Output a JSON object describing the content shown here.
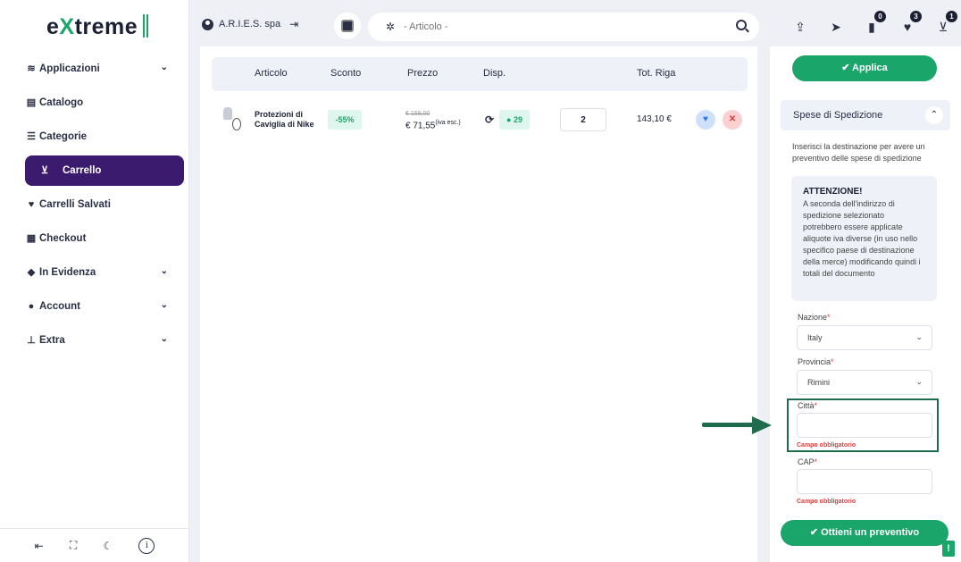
{
  "logo": {
    "part1": "e",
    "part2": "X",
    "part3": "treme"
  },
  "sidebar": {
    "items": [
      {
        "label": "Applicazioni",
        "icon": "layers-icon",
        "expandable": true
      },
      {
        "label": "Catalogo",
        "icon": "catalog-icon",
        "expandable": false
      },
      {
        "label": "Categorie",
        "icon": "list-icon",
        "expandable": false
      },
      {
        "label": "Carrello",
        "icon": "cart-icon",
        "expandable": false,
        "active": true
      },
      {
        "label": "Carrelli Salvati",
        "icon": "heart-icon",
        "expandable": false
      },
      {
        "label": "Checkout",
        "icon": "checkout-icon",
        "expandable": false
      },
      {
        "label": "In Evidenza",
        "icon": "tag-icon",
        "expandable": true
      },
      {
        "label": "Account",
        "icon": "user-icon",
        "expandable": true
      },
      {
        "label": "Extra",
        "icon": "sitemap-icon",
        "expandable": true
      }
    ]
  },
  "topbar": {
    "company": "A.R.I.E.S. spa",
    "search_placeholder": "- Articolo -",
    "badges": {
      "downloads": "0",
      "wishlist": "3",
      "cart": "1"
    }
  },
  "cart": {
    "headers": {
      "article": "Articolo",
      "discount": "Sconto",
      "price": "Prezzo",
      "availability": "Disp.",
      "row_total": "Tot. Riga"
    },
    "rows": [
      {
        "name": "Protezioni di Caviglia di Nike",
        "discount": "-55%",
        "price_old": "€ 159,00",
        "price_new": "€ 71,55",
        "price_note": "(iva esc.)",
        "stock": "● 29",
        "quantity": "2",
        "total": "143,10 €"
      }
    ]
  },
  "panel": {
    "apply_label": "✔ Applica",
    "shipping_title": "Spese di Spedizione",
    "shipping_desc": "Inserisci la destinazione per avere un preventivo delle spese di spedizione",
    "warning_title": "ATTENZIONE!",
    "warning_body": "A seconda dell'indirizzo di spedizione selezionato potrebbero essere applicate aliquote iva diverse (in uso nello specifico paese di destinazione della merce) modificando quindi i totali del documento",
    "fields": {
      "nation_label": "Nazione",
      "nation_value": "Italy",
      "province_label": "Provincia",
      "province_value": "Rimini",
      "city_label": "Città",
      "city_error": "Campo obbligatorio",
      "cap_label": "CAP",
      "cap_error": "Campo obbligatorio"
    },
    "quote_label": "✔ Ottieni un preventivo"
  },
  "colors": {
    "accent": "#1aa56a",
    "active_nav": "#3a1b6e",
    "highlight": "#1f6b4e"
  }
}
